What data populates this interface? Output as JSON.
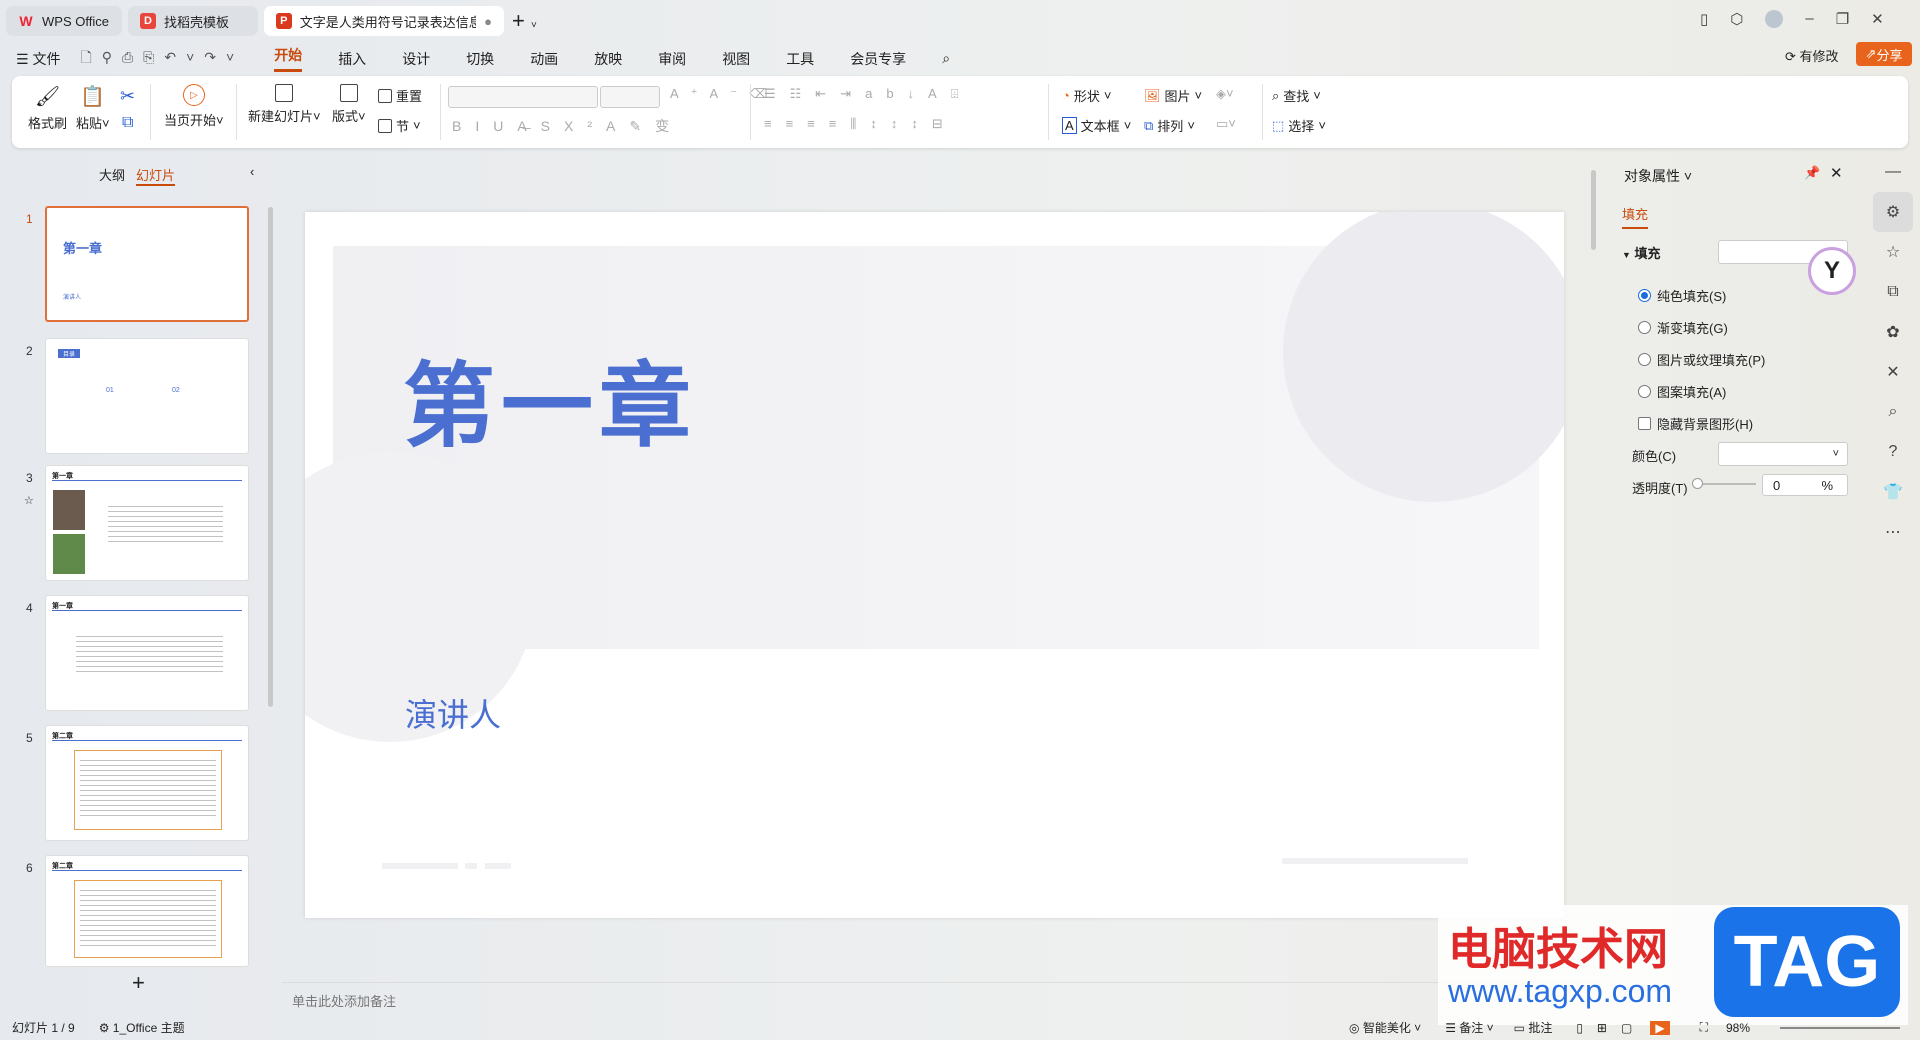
{
  "tabs": [
    {
      "label": "WPS Office",
      "icon": "W"
    },
    {
      "label": "找稻壳模板",
      "icon": "D"
    },
    {
      "label": "文字是人类用符号记录表达信息以",
      "icon": "P"
    }
  ],
  "menu": {
    "file": "文件",
    "items": [
      "开始",
      "插入",
      "设计",
      "切换",
      "动画",
      "放映",
      "审阅",
      "视图",
      "工具",
      "会员专享"
    ],
    "active": "开始"
  },
  "topright": {
    "modified": "有修改",
    "share": "分享"
  },
  "ribbon": {
    "format_painter": "格式刷",
    "paste": "粘贴",
    "play_current": "当页开始",
    "new_slide": "新建幻灯片",
    "layout": "版式",
    "reset": "重置",
    "section": "节",
    "shape": "形状",
    "picture": "图片",
    "textbox": "文本框",
    "arrange": "排列",
    "find": "查找",
    "select": "选择"
  },
  "left": {
    "outline": "大纲",
    "slides": "幻灯片",
    "add": "+"
  },
  "thumbs": [
    {
      "n": "1",
      "title": "第一章",
      "sub": "演讲人"
    },
    {
      "n": "2",
      "title": "目录",
      "a": "01",
      "b": "02"
    },
    {
      "n": "3",
      "title": "第一章"
    },
    {
      "n": "4",
      "title": "第一章"
    },
    {
      "n": "5",
      "title": "第二章"
    },
    {
      "n": "6",
      "title": "第二章"
    }
  ],
  "slide": {
    "title": "第一章",
    "subtitle": "演讲人",
    "title_color": "#4a6fd0"
  },
  "notes_placeholder": "单击此处添加备注",
  "panel": {
    "title": "对象属性",
    "tab": "填充",
    "section": "填充",
    "options": [
      "纯色填充(S)",
      "渐变填充(G)",
      "图片或纹理填充(P)",
      "图案填充(A)"
    ],
    "checkbox": "隐藏背景图形(H)",
    "color_label": "颜色(C)",
    "transparency_label": "透明度(T)",
    "transparency_value": "0",
    "percent": "%"
  },
  "status": {
    "slide_count": "幻灯片 1 / 9",
    "theme": "1_Office 主题",
    "beautify": "智能美化",
    "notes": "备注",
    "comment": "批注",
    "zoom": "98%"
  },
  "watermark": {
    "text1": "电脑技术网",
    "text2": "www.tagxp.com",
    "logo": "TAG"
  }
}
